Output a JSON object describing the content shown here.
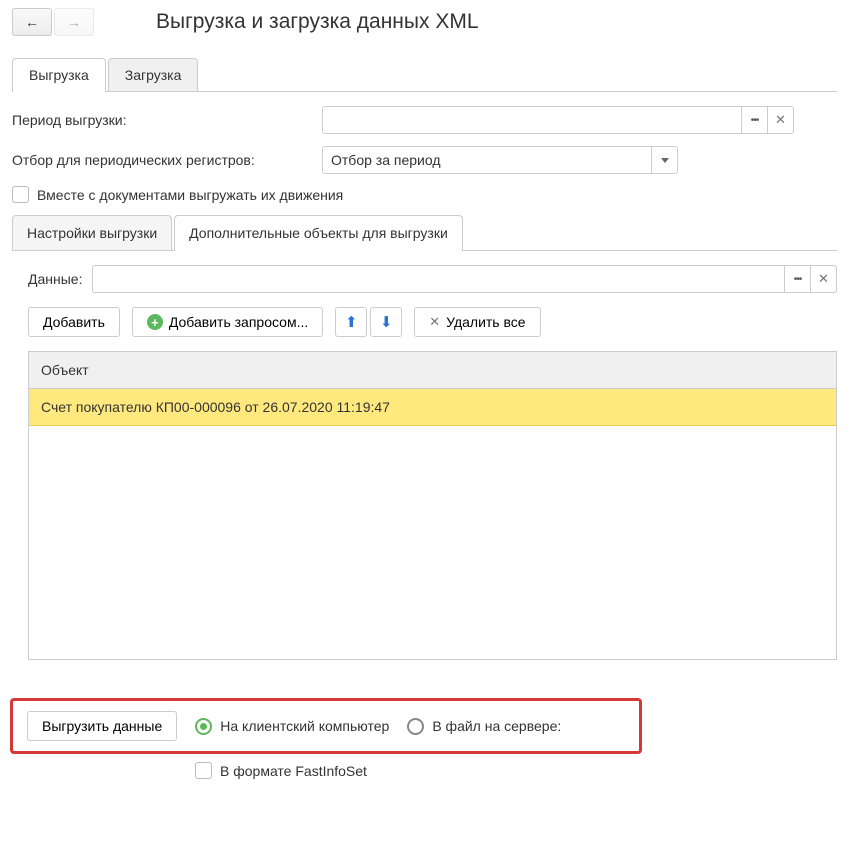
{
  "header": {
    "title": "Выгрузка и загрузка данных XML"
  },
  "tabs": {
    "export": "Выгрузка",
    "import": "Загрузка"
  },
  "form": {
    "period_label": "Период выгрузки:",
    "filter_label": "Отбор для периодических регистров:",
    "filter_value": "Отбор за период",
    "checkbox_movements": "Вместе с документами выгружать их движения"
  },
  "sub_tabs": {
    "settings": "Настройки выгрузки",
    "additional": "Дополнительные объекты для выгрузки"
  },
  "additional": {
    "data_label": "Данные:",
    "add_btn": "Добавить",
    "add_query_btn": "Добавить запросом...",
    "delete_all_btn": "Удалить все"
  },
  "table": {
    "header": "Объект",
    "rows": [
      "Счет покупателю КП00-000096 от 26.07.2020 11:19:47"
    ]
  },
  "footer": {
    "export_btn": "Выгрузить данные",
    "radio_client": "На клиентский компьютер",
    "radio_server": "В файл на сервере:",
    "fastinfo": "В формате FastInfoSet"
  }
}
